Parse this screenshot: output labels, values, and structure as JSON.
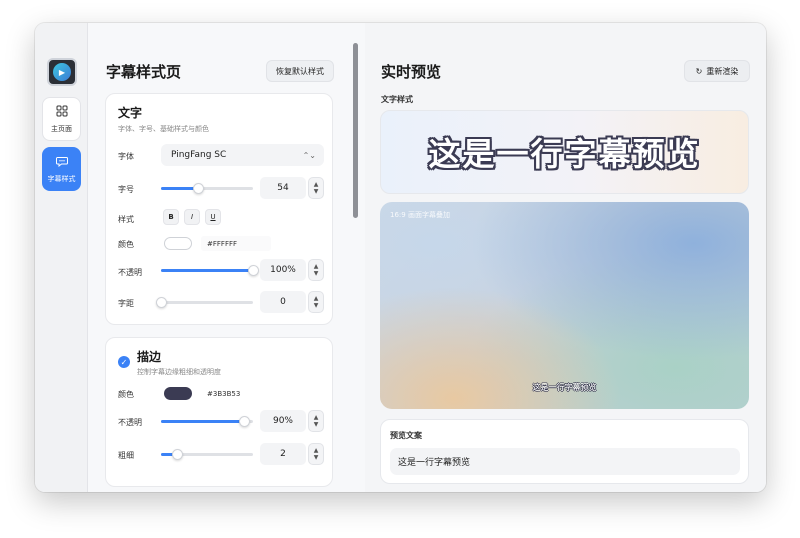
{
  "sidebar": {
    "items": [
      {
        "label": "主页面",
        "icon": "grid-icon"
      },
      {
        "label": "字幕样式",
        "icon": "chat-bubble-icon"
      }
    ]
  },
  "left": {
    "title": "字幕样式页",
    "reset_label": "恢复默认样式",
    "text_card": {
      "title": "文字",
      "subtitle": "字体、字号、基础样式与颜色",
      "font_label": "字体",
      "font_value": "PingFang SC",
      "size_label": "字号",
      "size_value": "54",
      "size_level": 0.4,
      "style_label": "样式",
      "style_bold": "B",
      "style_italic": "I",
      "style_underline": "U",
      "color_label": "颜色",
      "color_value": "#FFFFFF",
      "opacity_label": "不透明",
      "opacity_value": "100%",
      "opacity_level": 1.0,
      "spacing_label": "字距",
      "spacing_value": "0",
      "spacing_level": 0.0
    },
    "stroke_card": {
      "title": "描边",
      "subtitle": "控制字幕边缘粗细和透明度",
      "color_label": "颜色",
      "color_value": "#3B3B53",
      "opacity_label": "不透明",
      "opacity_value": "90%",
      "opacity_level": 0.9,
      "width_label": "粗细",
      "width_value": "2",
      "width_level": 0.17
    }
  },
  "right": {
    "title": "实时预览",
    "rerender_label": "重新渲染",
    "text_style_label": "文字样式",
    "preview_text": "这是一行字幕预览",
    "video_label": "16:9 画面字幕叠加",
    "video_subtitle": "这是一行字幕预览",
    "preview_copy_label": "预览文案",
    "preview_copy_value": "这是一行字幕预览"
  },
  "colors": {
    "accent": "#3b82f6",
    "stroke": "#3b3b53",
    "text": "#ffffff"
  }
}
